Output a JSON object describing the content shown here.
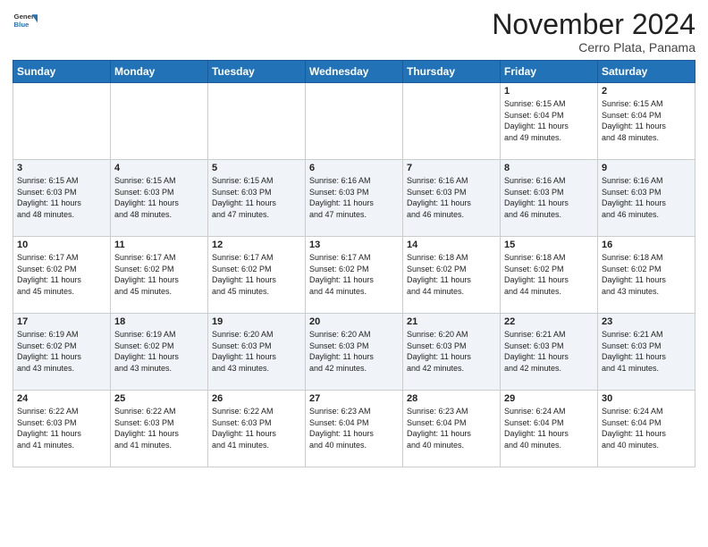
{
  "header": {
    "logo": {
      "general": "General",
      "blue": "Blue"
    },
    "title": "November 2024",
    "location": "Cerro Plata, Panama"
  },
  "weekdays": [
    "Sunday",
    "Monday",
    "Tuesday",
    "Wednesday",
    "Thursday",
    "Friday",
    "Saturday"
  ],
  "weeks": [
    [
      {
        "day": "",
        "info": ""
      },
      {
        "day": "",
        "info": ""
      },
      {
        "day": "",
        "info": ""
      },
      {
        "day": "",
        "info": ""
      },
      {
        "day": "",
        "info": ""
      },
      {
        "day": "1",
        "info": "Sunrise: 6:15 AM\nSunset: 6:04 PM\nDaylight: 11 hours\nand 49 minutes."
      },
      {
        "day": "2",
        "info": "Sunrise: 6:15 AM\nSunset: 6:04 PM\nDaylight: 11 hours\nand 48 minutes."
      }
    ],
    [
      {
        "day": "3",
        "info": "Sunrise: 6:15 AM\nSunset: 6:03 PM\nDaylight: 11 hours\nand 48 minutes."
      },
      {
        "day": "4",
        "info": "Sunrise: 6:15 AM\nSunset: 6:03 PM\nDaylight: 11 hours\nand 48 minutes."
      },
      {
        "day": "5",
        "info": "Sunrise: 6:15 AM\nSunset: 6:03 PM\nDaylight: 11 hours\nand 47 minutes."
      },
      {
        "day": "6",
        "info": "Sunrise: 6:16 AM\nSunset: 6:03 PM\nDaylight: 11 hours\nand 47 minutes."
      },
      {
        "day": "7",
        "info": "Sunrise: 6:16 AM\nSunset: 6:03 PM\nDaylight: 11 hours\nand 46 minutes."
      },
      {
        "day": "8",
        "info": "Sunrise: 6:16 AM\nSunset: 6:03 PM\nDaylight: 11 hours\nand 46 minutes."
      },
      {
        "day": "9",
        "info": "Sunrise: 6:16 AM\nSunset: 6:03 PM\nDaylight: 11 hours\nand 46 minutes."
      }
    ],
    [
      {
        "day": "10",
        "info": "Sunrise: 6:17 AM\nSunset: 6:02 PM\nDaylight: 11 hours\nand 45 minutes."
      },
      {
        "day": "11",
        "info": "Sunrise: 6:17 AM\nSunset: 6:02 PM\nDaylight: 11 hours\nand 45 minutes."
      },
      {
        "day": "12",
        "info": "Sunrise: 6:17 AM\nSunset: 6:02 PM\nDaylight: 11 hours\nand 45 minutes."
      },
      {
        "day": "13",
        "info": "Sunrise: 6:17 AM\nSunset: 6:02 PM\nDaylight: 11 hours\nand 44 minutes."
      },
      {
        "day": "14",
        "info": "Sunrise: 6:18 AM\nSunset: 6:02 PM\nDaylight: 11 hours\nand 44 minutes."
      },
      {
        "day": "15",
        "info": "Sunrise: 6:18 AM\nSunset: 6:02 PM\nDaylight: 11 hours\nand 44 minutes."
      },
      {
        "day": "16",
        "info": "Sunrise: 6:18 AM\nSunset: 6:02 PM\nDaylight: 11 hours\nand 43 minutes."
      }
    ],
    [
      {
        "day": "17",
        "info": "Sunrise: 6:19 AM\nSunset: 6:02 PM\nDaylight: 11 hours\nand 43 minutes."
      },
      {
        "day": "18",
        "info": "Sunrise: 6:19 AM\nSunset: 6:02 PM\nDaylight: 11 hours\nand 43 minutes."
      },
      {
        "day": "19",
        "info": "Sunrise: 6:20 AM\nSunset: 6:03 PM\nDaylight: 11 hours\nand 43 minutes."
      },
      {
        "day": "20",
        "info": "Sunrise: 6:20 AM\nSunset: 6:03 PM\nDaylight: 11 hours\nand 42 minutes."
      },
      {
        "day": "21",
        "info": "Sunrise: 6:20 AM\nSunset: 6:03 PM\nDaylight: 11 hours\nand 42 minutes."
      },
      {
        "day": "22",
        "info": "Sunrise: 6:21 AM\nSunset: 6:03 PM\nDaylight: 11 hours\nand 42 minutes."
      },
      {
        "day": "23",
        "info": "Sunrise: 6:21 AM\nSunset: 6:03 PM\nDaylight: 11 hours\nand 41 minutes."
      }
    ],
    [
      {
        "day": "24",
        "info": "Sunrise: 6:22 AM\nSunset: 6:03 PM\nDaylight: 11 hours\nand 41 minutes."
      },
      {
        "day": "25",
        "info": "Sunrise: 6:22 AM\nSunset: 6:03 PM\nDaylight: 11 hours\nand 41 minutes."
      },
      {
        "day": "26",
        "info": "Sunrise: 6:22 AM\nSunset: 6:03 PM\nDaylight: 11 hours\nand 41 minutes."
      },
      {
        "day": "27",
        "info": "Sunrise: 6:23 AM\nSunset: 6:04 PM\nDaylight: 11 hours\nand 40 minutes."
      },
      {
        "day": "28",
        "info": "Sunrise: 6:23 AM\nSunset: 6:04 PM\nDaylight: 11 hours\nand 40 minutes."
      },
      {
        "day": "29",
        "info": "Sunrise: 6:24 AM\nSunset: 6:04 PM\nDaylight: 11 hours\nand 40 minutes."
      },
      {
        "day": "30",
        "info": "Sunrise: 6:24 AM\nSunset: 6:04 PM\nDaylight: 11 hours\nand 40 minutes."
      }
    ]
  ]
}
